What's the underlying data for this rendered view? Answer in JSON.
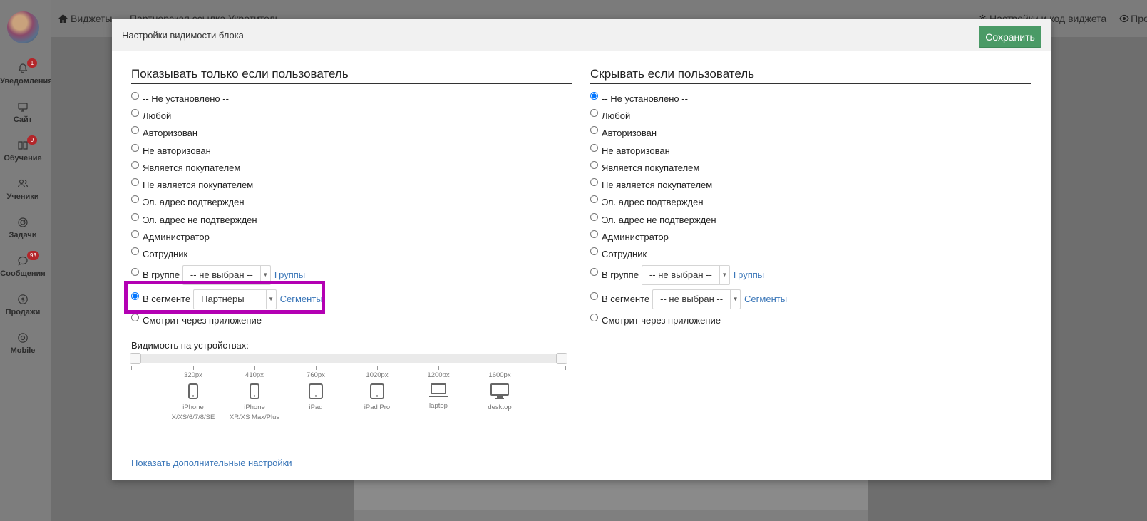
{
  "sidebar": {
    "items": [
      {
        "label": "Уведомления",
        "icon": "bell-icon",
        "badge": "1"
      },
      {
        "label": "Сайт",
        "icon": "monitor-icon",
        "badge": ""
      },
      {
        "label": "Обучение",
        "icon": "book-icon",
        "badge": "9"
      },
      {
        "label": "Ученики",
        "icon": "users-icon",
        "badge": ""
      },
      {
        "label": "Задачи",
        "icon": "target-icon",
        "badge": ""
      },
      {
        "label": "Сообщения",
        "icon": "chat-icon",
        "badge": "93"
      },
      {
        "label": "Продажи",
        "icon": "dollar-icon",
        "badge": ""
      },
      {
        "label": "Mobile",
        "icon": "mobile-icon",
        "badge": ""
      }
    ]
  },
  "topbar": {
    "breadcrumb_widgets": "Виджеты",
    "breadcrumb_separator": "·",
    "breadcrumb_current": "Партнерская ссылка Укротитель",
    "settings_link": "Настройки и код виджета",
    "preview_link": "Просм"
  },
  "modal": {
    "title": "Настройки видимости блока",
    "save_label": "Сохранить",
    "left": {
      "heading": "Показывать только если пользователь",
      "options": [
        "-- Не установлено --",
        "Любой",
        "Авторизован",
        "Не авторизован",
        "Является покупателем",
        "Не является покупателем",
        "Эл. адрес подтвержден",
        "Эл. адрес не подтвержден",
        "Администратор",
        "Сотрудник"
      ],
      "group_label": "В группе",
      "group_value": "-- не выбран --",
      "group_link": "Группы",
      "segment_label": "В сегменте",
      "segment_value": "Партнёры",
      "segment_link": "Сегменты",
      "app_label": "Смотрит через приложение",
      "selected": "segment"
    },
    "right": {
      "heading": "Скрывать если пользователь",
      "options": [
        "-- Не установлено --",
        "Любой",
        "Авторизован",
        "Не авторизован",
        "Является покупателем",
        "Не является покупателем",
        "Эл. адрес подтвержден",
        "Эл. адрес не подтвержден",
        "Администратор",
        "Сотрудник"
      ],
      "group_label": "В группе",
      "group_value": "-- не выбран --",
      "group_link": "Группы",
      "segment_label": "В сегменте",
      "segment_value": "-- не выбран --",
      "segment_link": "Сегменты",
      "app_label": "Смотрит через приложение",
      "selected": "not_set"
    },
    "devices": {
      "label": "Видимость на устройствах:",
      "range_min": 0,
      "range_max": 1,
      "list": [
        {
          "px": "320px",
          "name1": "iPhone",
          "name2": "X/XS/6/7/8/SE",
          "icon": "phone-icon"
        },
        {
          "px": "410px",
          "name1": "iPhone",
          "name2": "XR/XS Max/Plus",
          "icon": "phone-icon"
        },
        {
          "px": "760px",
          "name1": "iPad",
          "name2": "",
          "icon": "tablet-icon"
        },
        {
          "px": "1020px",
          "name1": "iPad Pro",
          "name2": "",
          "icon": "tablet-icon"
        },
        {
          "px": "1200px",
          "name1": "laptop",
          "name2": "",
          "icon": "laptop-icon"
        },
        {
          "px": "1600px",
          "name1": "desktop",
          "name2": "",
          "icon": "desktop-icon"
        }
      ]
    },
    "more_settings": "Показать дополнительные настройки"
  },
  "colors": {
    "accent_button": "#4a9a66",
    "link": "#3a76b8",
    "highlight": "#b300b3",
    "badge": "#b3262a"
  }
}
